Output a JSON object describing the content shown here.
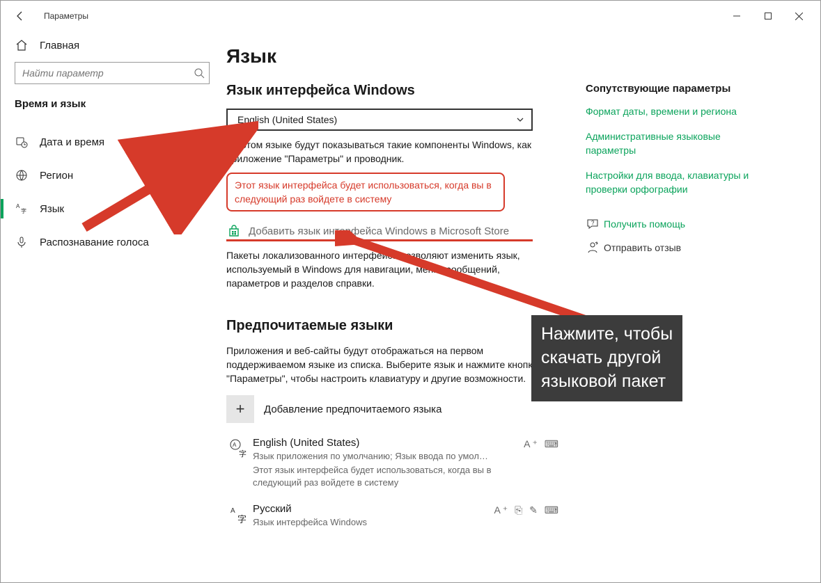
{
  "window": {
    "title": "Параметры"
  },
  "search": {
    "placeholder": "Найти параметр"
  },
  "sidebar": {
    "home": "Главная",
    "category": "Время и язык",
    "items": [
      {
        "label": "Дата и время"
      },
      {
        "label": "Регион"
      },
      {
        "label": "Язык"
      },
      {
        "label": "Распознавание голоса"
      }
    ]
  },
  "main": {
    "page_title": "Язык",
    "display_lang": {
      "heading": "Язык интерфейса Windows",
      "selected": "English (United States)",
      "description": "На этом языке будут показываться такие компоненты Windows, как приложение \"Параметры\" и проводник.",
      "highlight": "Этот язык интерфейса будет использоваться, когда вы в следующий раз войдете в систему",
      "store_link": "Добавить язык интерфейса Windows в Microsoft Store",
      "store_desc": "Пакеты локализованного интерфейса позволяют изменить язык, используемый в Windows для навигации, меню, сообщений, параметров и разделов справки."
    },
    "preferred": {
      "heading": "Предпочитаемые языки",
      "description": "Приложения и веб-сайты будут отображаться на первом поддерживаемом языке из списка. Выберите язык и нажмите кнопку \"Параметры\", чтобы настроить клавиатуру и другие возможности.",
      "add_label": "Добавление предпочитаемого языка",
      "langs": [
        {
          "name": "English (United States)",
          "sub": "Язык приложения по умолчанию; Язык ввода по умол…",
          "note": "Этот язык интерфейса будет использоваться, когда вы в следующий раз войдете в систему",
          "badges": "A⁺  ⌨"
        },
        {
          "name": "Русский",
          "sub": "Язык интерфейса Windows",
          "badges": "A⁺ ⎘ ✎ ⌨"
        }
      ]
    }
  },
  "related": {
    "heading": "Сопутствующие параметры",
    "links": [
      "Формат даты, времени и региона",
      "Административные языковые параметры",
      "Настройки для ввода, клавиатуры и проверки орфографии"
    ],
    "help": "Получить помощь",
    "feedback": "Отправить отзыв"
  },
  "annotation": {
    "callout": "Нажмите, чтобы\nскачать другой\nязыковой пакет"
  }
}
